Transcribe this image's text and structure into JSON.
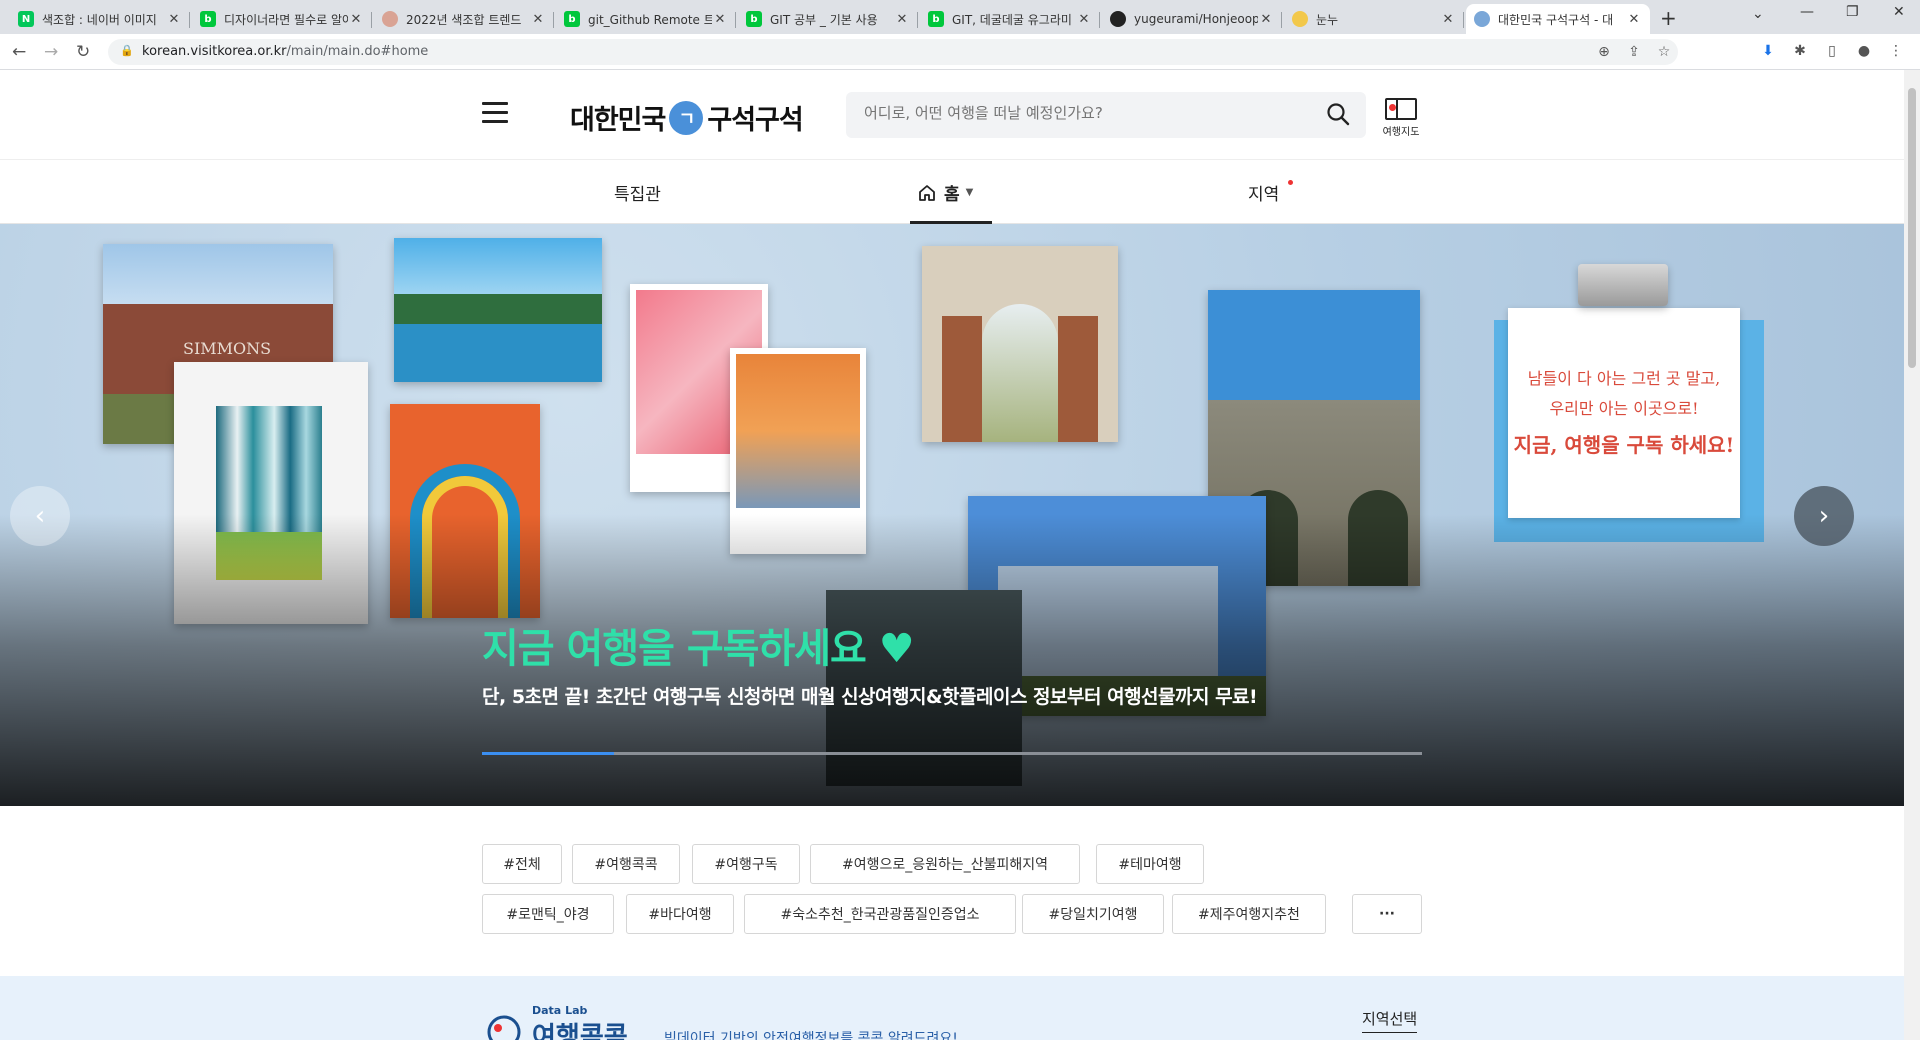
{
  "browser": {
    "tabs": [
      {
        "label": "색조합 : 네이버 이미지",
        "favicon": "N",
        "favicon_color": "#03c75a"
      },
      {
        "label": "디자이너라면 필수로 알아야",
        "favicon": "b",
        "favicon_color": "#00c73c"
      },
      {
        "label": "2022년 색조합 트렌드",
        "favicon": "",
        "favicon_color": "#d9a394"
      },
      {
        "label": "git_Github Remote 트",
        "favicon": "b",
        "favicon_color": "#00c73c"
      },
      {
        "label": "GIT 공부 _ 기본 사용",
        "favicon": "b",
        "favicon_color": "#00c73c"
      },
      {
        "label": "GIT, 데굴데굴 유그라미",
        "favicon": "b",
        "favicon_color": "#00c73c"
      },
      {
        "label": "yugeurami/Honjeoop",
        "favicon": "",
        "favicon_color": "#222222"
      },
      {
        "label": "눈누",
        "favicon": "",
        "favicon_color": "#f2c84b"
      },
      {
        "label": "대한민국 구석구석 - 대",
        "favicon": "",
        "favicon_color": "#7aa7d8"
      }
    ],
    "url_host": "korean.visitkorea.or.kr",
    "url_path": "/main/main.do#home"
  },
  "header": {
    "logo_left": "대한민국",
    "logo_mark": "ㄱ",
    "logo_right": "구석구석",
    "search_placeholder": "어디로, 어떤 여행을 떠날 예정인가요?",
    "map_label": "여행지도"
  },
  "gnb": {
    "items": [
      "특집관",
      "홈",
      "지역"
    ]
  },
  "hero": {
    "title": "지금 여행을 구독하세요 ♥",
    "subtitle": "단, 5초면 끝! 초간단 여행구독 신청하면 매월 신상여행지&핫플레이스 정보부터 여행선물까지 무료!",
    "progress": 0.14,
    "note_lines": [
      "남들이 다 아는 그런 곳 말고,",
      "우리만 아는 이곳으로!",
      "지금, 여행을 구독 하세요!"
    ],
    "sign_text": "SIMMONS",
    "prev_icon": "‹",
    "next_icon": "›"
  },
  "tags": {
    "row1": [
      "#전체",
      "#여행콕콕",
      "#여행구독",
      "#여행으로_응원하는_산불피해지역",
      "#테마여행"
    ],
    "row2": [
      "#로맨틱_야경",
      "#바다여행",
      "#숙소추천_한국관광품질인증업소",
      "#당일치기여행",
      "#제주여행지추천"
    ],
    "more": "···"
  },
  "datalab": {
    "small": "Data Lab",
    "big": "여행콕콕",
    "desc": "빅데이터 기반의 안전여행정보를 콕콕 알려드려요!",
    "region": "지역선택"
  }
}
